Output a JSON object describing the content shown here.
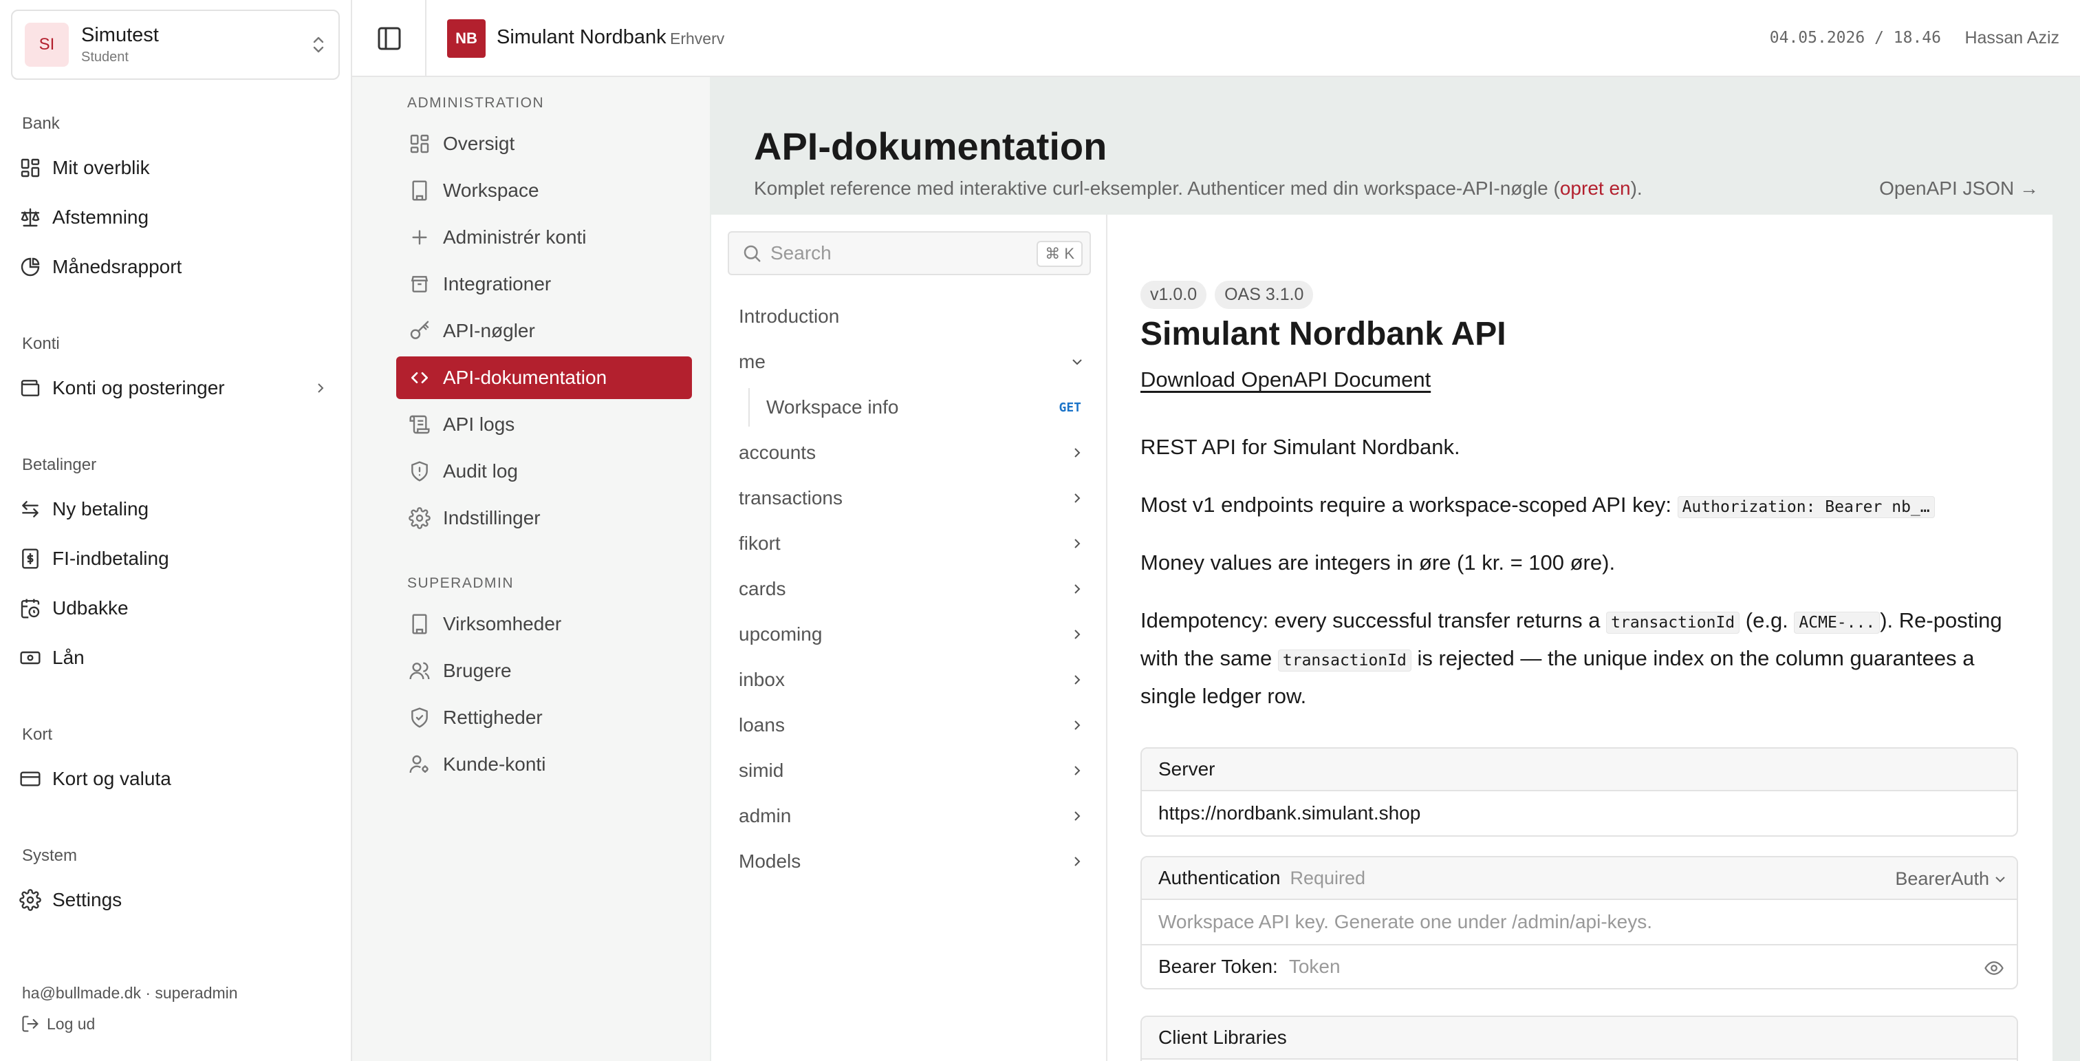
{
  "workspace": {
    "initials": "SI",
    "name": "Simutest",
    "role": "Student"
  },
  "sidebar": {
    "sections": [
      {
        "label": "Bank",
        "items": [
          {
            "label": "Mit overblik",
            "icon": "dashboard-icon"
          },
          {
            "label": "Afstemning",
            "icon": "scale-icon"
          },
          {
            "label": "Månedsrapport",
            "icon": "pie-chart-icon"
          }
        ]
      },
      {
        "label": "Konti",
        "items": [
          {
            "label": "Konti og posteringer",
            "icon": "wallet-icon"
          }
        ]
      },
      {
        "label": "Betalinger",
        "items": [
          {
            "label": "Ny betaling",
            "icon": "transfer-icon"
          },
          {
            "label": "FI-indbetaling",
            "icon": "receipt-icon"
          },
          {
            "label": "Udbakke",
            "icon": "calendar-clock-icon"
          },
          {
            "label": "Lån",
            "icon": "banknote-icon"
          }
        ]
      },
      {
        "label": "Kort",
        "items": [
          {
            "label": "Kort og valuta",
            "icon": "credit-card-icon"
          }
        ]
      },
      {
        "label": "System",
        "items": [
          {
            "label": "Settings",
            "icon": "gear-icon"
          }
        ]
      }
    ],
    "footer_email": "ha@bullmade.dk · superadmin",
    "logout": "Log ud"
  },
  "header": {
    "brand_logo": "NB",
    "brand_name": "Simulant Nordbank",
    "brand_sub": "Erhverv",
    "datetime": "04.05.2026 / 18.46",
    "user": "Hassan Aziz"
  },
  "admin": {
    "section1": "ADMINISTRATION",
    "items1": [
      {
        "label": "Oversigt",
        "icon": "grid-icon"
      },
      {
        "label": "Workspace",
        "icon": "building-icon"
      },
      {
        "label": "Administrér konti",
        "icon": "plus-icon"
      },
      {
        "label": "Integrationer",
        "icon": "box-icon"
      },
      {
        "label": "API-nøgler",
        "icon": "key-icon"
      },
      {
        "label": "API-dokumentation",
        "icon": "code-icon",
        "active": true
      },
      {
        "label": "API logs",
        "icon": "scroll-icon"
      },
      {
        "label": "Audit log",
        "icon": "shield-alert-icon"
      },
      {
        "label": "Indstillinger",
        "icon": "gear-icon"
      }
    ],
    "section2": "SUPERADMIN",
    "items2": [
      {
        "label": "Virksomheder",
        "icon": "building-icon"
      },
      {
        "label": "Brugere",
        "icon": "users-icon"
      },
      {
        "label": "Rettigheder",
        "icon": "shield-check-icon"
      },
      {
        "label": "Kunde-konti",
        "icon": "user-cog-icon"
      }
    ]
  },
  "page": {
    "title": "API-dokumentation",
    "subtitle_before": "Komplet reference med interaktive curl-eksempler. Authenticer med din workspace-API-nøgle (",
    "subtitle_link": "opret en",
    "subtitle_after": ").",
    "openapi_link": "OpenAPI JSON →"
  },
  "docs_nav": {
    "search_placeholder": "Search",
    "search_shortcut": "⌘ K",
    "intro": "Introduction",
    "me": "me",
    "me_sub": {
      "label": "Workspace info",
      "method": "GET"
    },
    "groups": [
      "accounts",
      "transactions",
      "fikort",
      "cards",
      "upcoming",
      "inbox",
      "loans",
      "simid",
      "admin",
      "Models"
    ]
  },
  "docs": {
    "version_badge": "v1.0.0",
    "oas_badge": "OAS 3.1.0",
    "title": "Simulant Nordbank API",
    "download": "Download OpenAPI Document",
    "p1": "REST API for Simulant Nordbank.",
    "p2_text": "Most v1 endpoints require a workspace-scoped API key: ",
    "p2_code": "Authorization: Bearer nb_…",
    "p3": "Money values are integers in øre (1 kr. = 100 øre).",
    "p4_a": "Idempotency: every successful transfer returns a ",
    "p4_code1": "transactionId",
    "p4_b": " (e.g. ",
    "p4_code2": "ACME-...",
    "p4_c": "). Re-posting with the same ",
    "p4_code3": "transactionId",
    "p4_d": " is rejected — the unique index on the column guarantees a single ledger row.",
    "server_label": "Server",
    "server_url": "https://nordbank.simulant.shop",
    "auth_label": "Authentication",
    "auth_required": "Required",
    "auth_scheme": "BearerAuth",
    "auth_desc": "Workspace API key. Generate one under /admin/api-keys.",
    "token_label": "Bearer Token:",
    "token_placeholder": "Token",
    "client_libs": "Client Libraries"
  },
  "colors": {
    "accent": "#b3202e",
    "main_bg": "#e9edeb",
    "get_method": "#1a73c8"
  }
}
